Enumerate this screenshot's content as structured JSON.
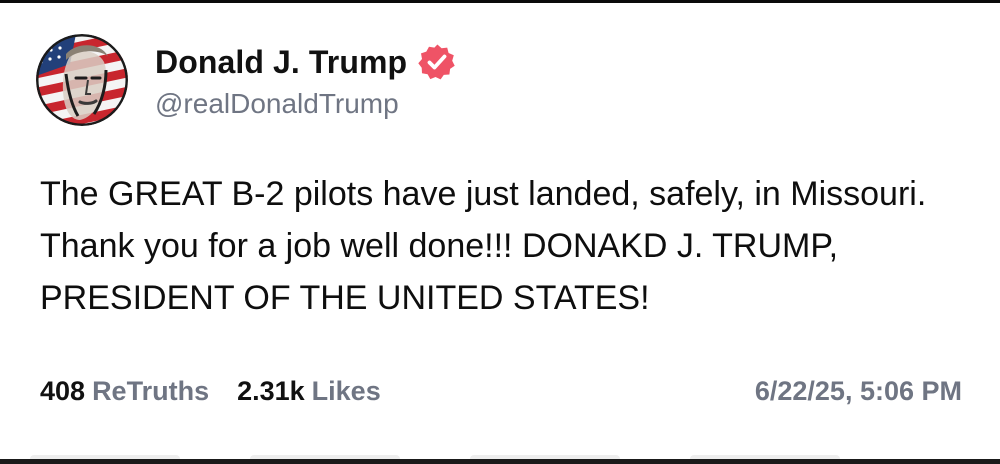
{
  "post": {
    "author": {
      "display_name": "Donald J. Trump",
      "handle": "@realDonaldTrump",
      "verified": true,
      "avatar_icon": "avatar-image",
      "verified_icon": "verified-badge-icon"
    },
    "body": "The GREAT B-2 pilots have just landed, safely, in Missouri. Thank you for a job well done!!! DONAKD J. TRUMP, PRESIDENT OF THE UNITED STATES!",
    "stats": {
      "retruths_count": "408",
      "retruths_label": "ReTruths",
      "likes_count": "2.31k",
      "likes_label": "Likes"
    },
    "timestamp": "6/22/25, 5:06 PM"
  },
  "colors": {
    "text_primary": "#111111",
    "text_secondary": "#6f7583",
    "verified_badge": "#ef5366",
    "background": "#ffffff"
  }
}
